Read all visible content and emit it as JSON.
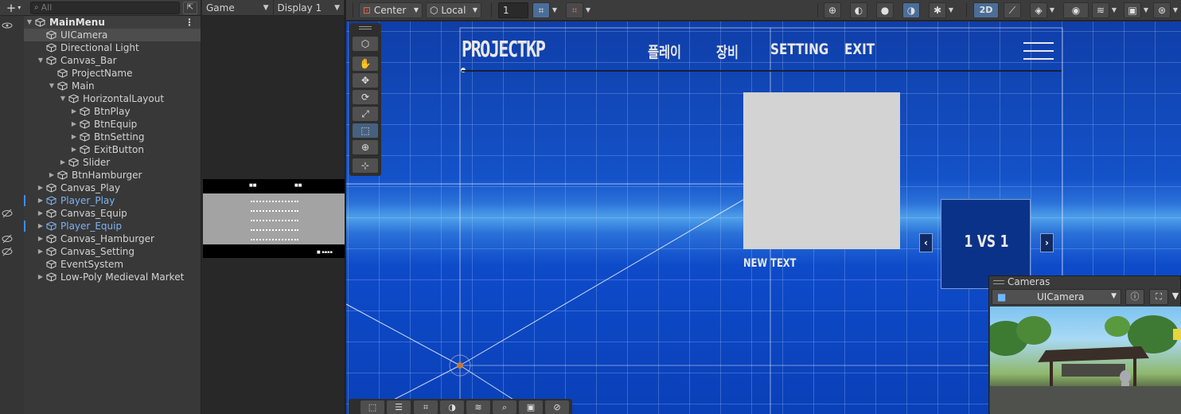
{
  "hierarchy": {
    "add_label": "+",
    "search_placeholder": "All",
    "scene_name": "MainMenu",
    "items": [
      {
        "label": "UICamera",
        "depth": 1,
        "expand": "none",
        "prefab": false,
        "selected": true
      },
      {
        "label": "Directional Light",
        "depth": 1,
        "expand": "none",
        "prefab": false
      },
      {
        "label": "Canvas_Bar",
        "depth": 1,
        "expand": "open",
        "prefab": false
      },
      {
        "label": "ProjectName",
        "depth": 2,
        "expand": "none",
        "prefab": false
      },
      {
        "label": "Main",
        "depth": 2,
        "expand": "open",
        "prefab": false
      },
      {
        "label": "HorizontalLayout",
        "depth": 3,
        "expand": "open",
        "prefab": false
      },
      {
        "label": "BtnPlay",
        "depth": 4,
        "expand": "closed",
        "prefab": false
      },
      {
        "label": "BtnEquip",
        "depth": 4,
        "expand": "closed",
        "prefab": false
      },
      {
        "label": "BtnSetting",
        "depth": 4,
        "expand": "closed",
        "prefab": false
      },
      {
        "label": "ExitButton",
        "depth": 4,
        "expand": "closed",
        "prefab": false
      },
      {
        "label": "Slider",
        "depth": 3,
        "expand": "closed",
        "prefab": false
      },
      {
        "label": "BtnHamburger",
        "depth": 2,
        "expand": "closed",
        "prefab": false
      },
      {
        "label": "Canvas_Play",
        "depth": 1,
        "expand": "closed",
        "prefab": false
      },
      {
        "label": "Player_Play",
        "depth": 1,
        "expand": "closed",
        "prefab": true
      },
      {
        "label": "Canvas_Equip",
        "depth": 1,
        "expand": "closed",
        "prefab": false,
        "hidden": true
      },
      {
        "label": "Player_Equip",
        "depth": 1,
        "expand": "closed",
        "prefab": true
      },
      {
        "label": "Canvas_Hamburger",
        "depth": 1,
        "expand": "closed",
        "prefab": false,
        "hidden": true
      },
      {
        "label": "Canvas_Setting",
        "depth": 1,
        "expand": "closed",
        "prefab": false,
        "hidden": true
      },
      {
        "label": "EventSystem",
        "depth": 1,
        "expand": "none",
        "prefab": false
      },
      {
        "label": "Low-Poly Medieval Market",
        "depth": 1,
        "expand": "closed",
        "prefab": false
      }
    ]
  },
  "game": {
    "tab_label": "Game",
    "display_label": "Display 1"
  },
  "scene_toolbar": {
    "pivot_label": "Center",
    "space_label": "Local",
    "grid_value": "1",
    "mode_2d_label": "2D"
  },
  "canvas_ui": {
    "title": "PROJECTKP",
    "menu": [
      "플레이",
      "장비",
      "SETTING",
      "EXIT"
    ],
    "new_text": "NEW TEXT",
    "vs_text": "1 VS 1",
    "prev_glyph": "‹",
    "next_glyph": "›"
  },
  "cameras_overlay": {
    "title": "Cameras",
    "selected_camera": "UICamera"
  },
  "colors": {
    "accent": "#4a6e99",
    "prefab_blue": "#7eb2f2",
    "scene_bg": "#1452c9"
  }
}
